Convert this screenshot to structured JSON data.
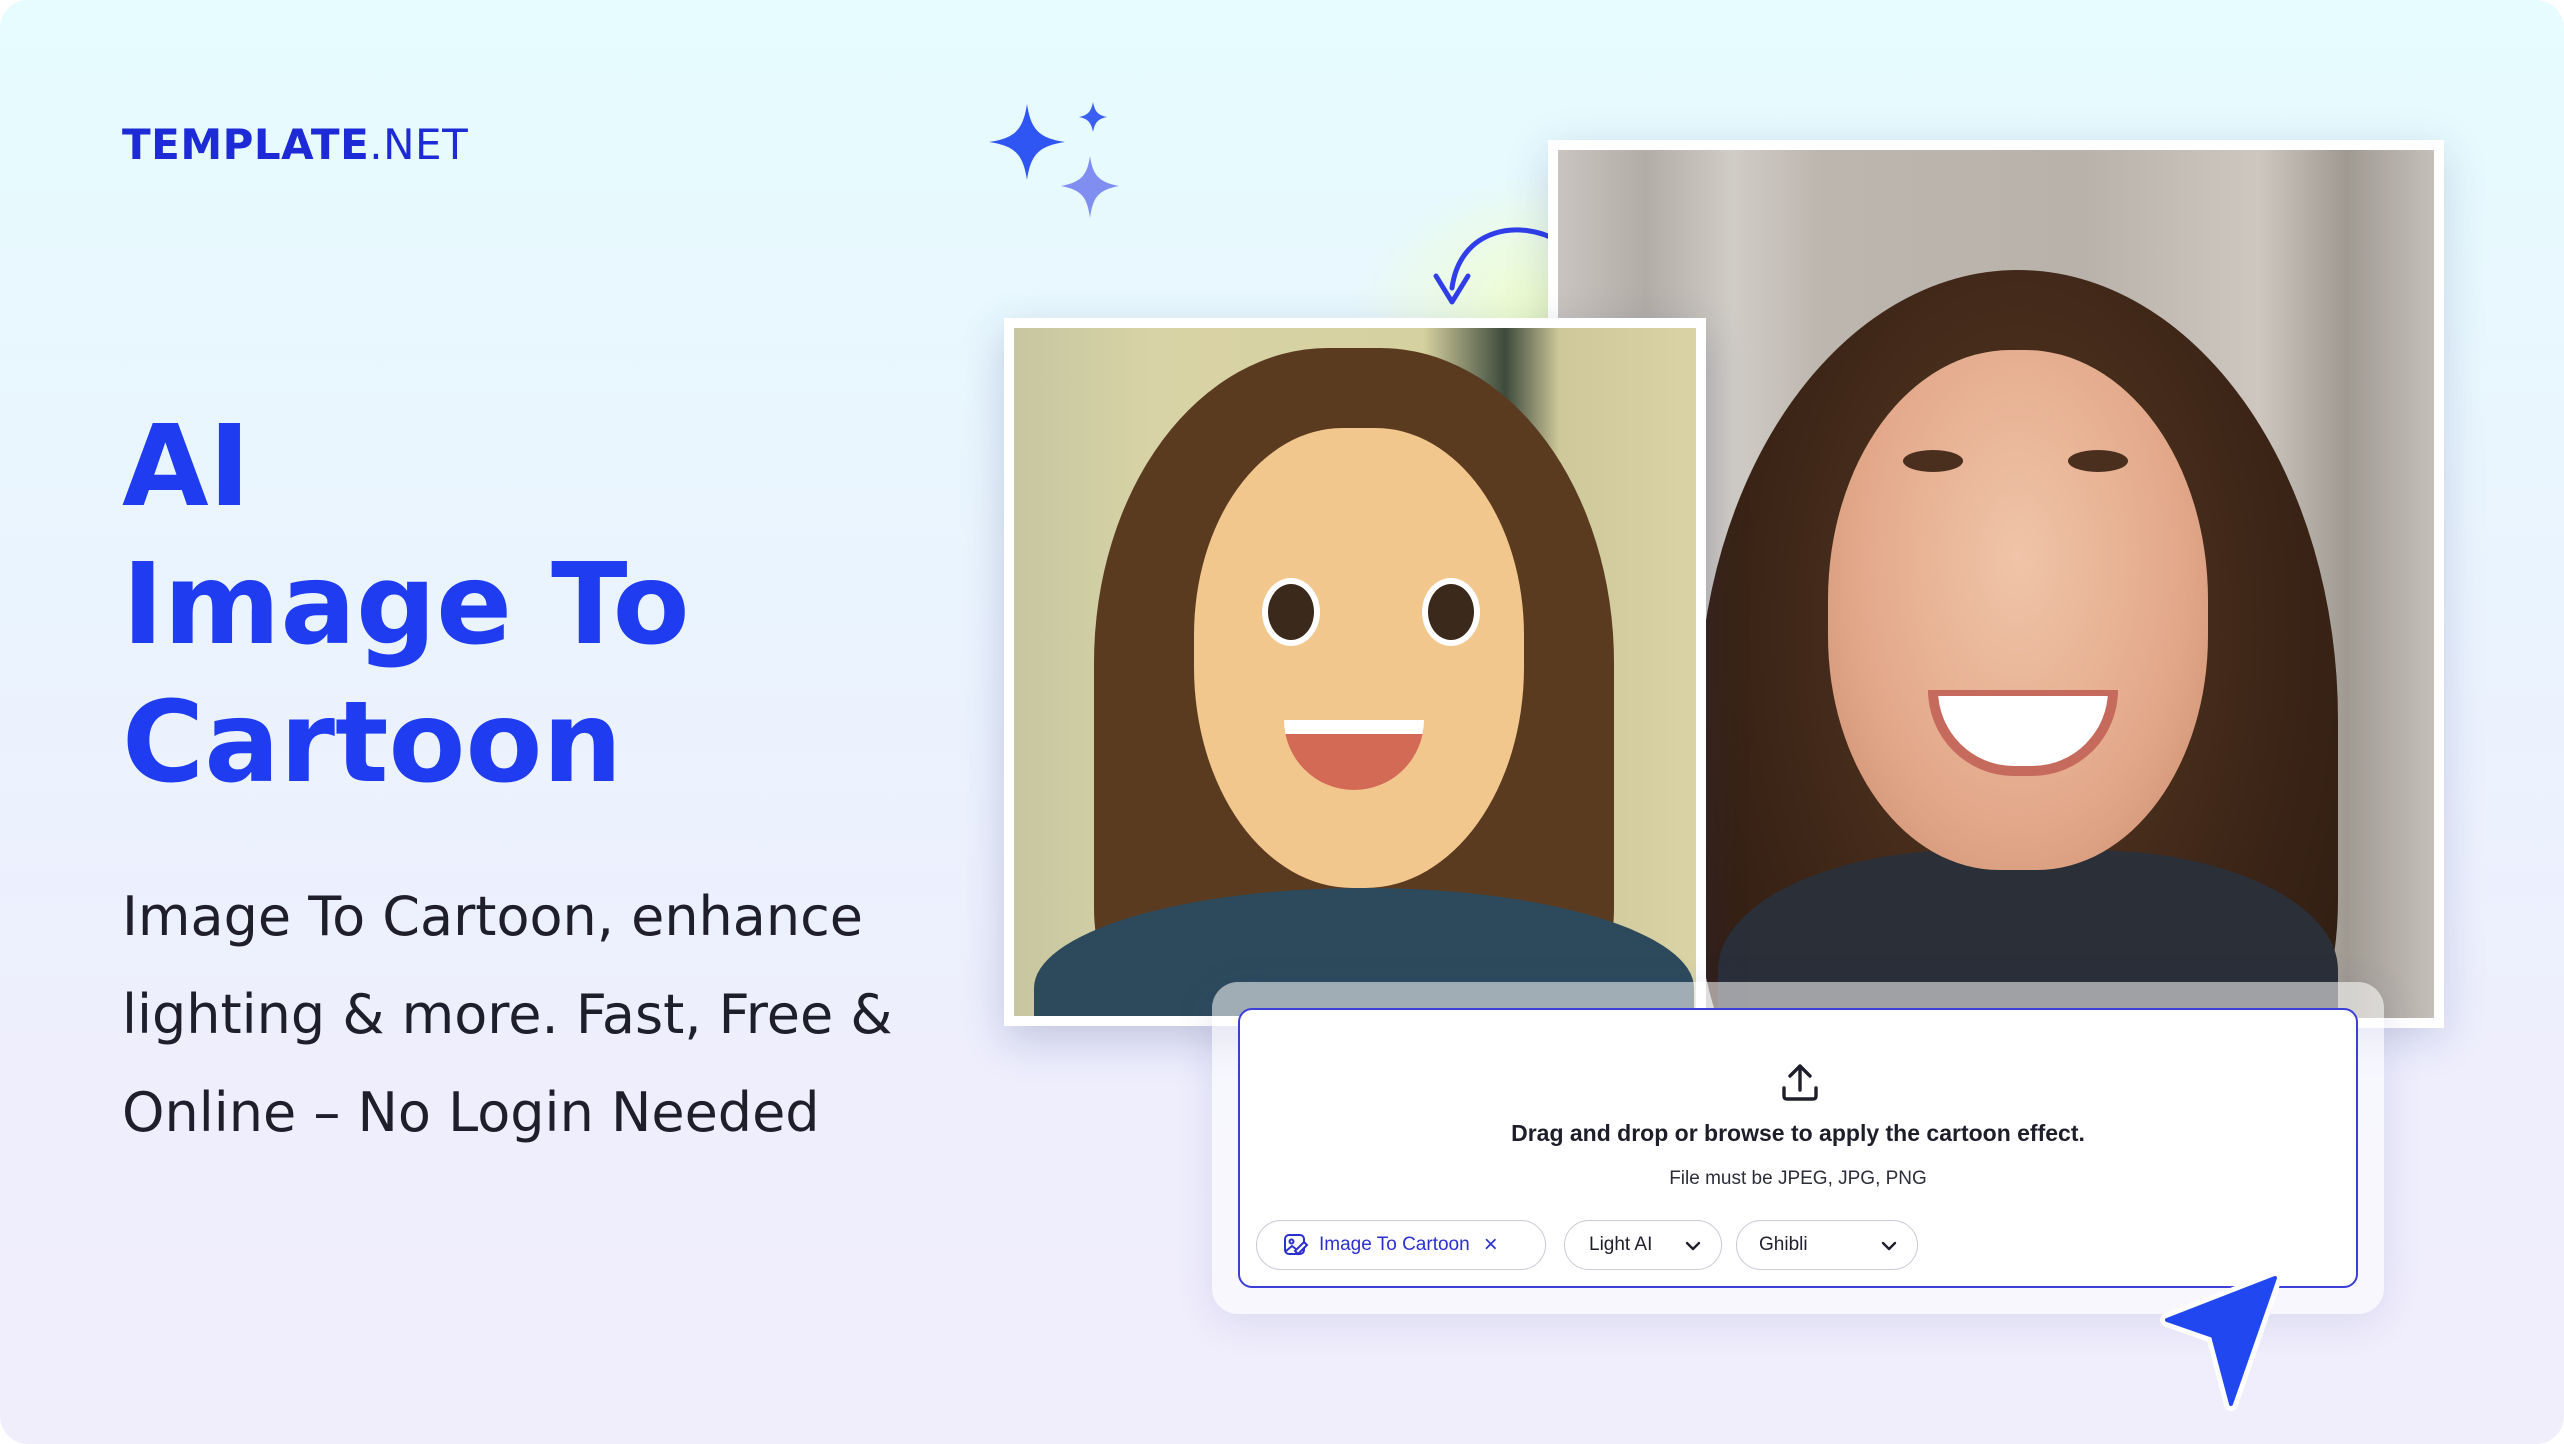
{
  "brand": {
    "logo_bold": "TEMPLATE",
    "logo_rest": ".NET"
  },
  "hero": {
    "title_lines": [
      "AI",
      "Image To",
      "Cartoon"
    ],
    "subtitle": "Image To Cartoon, enhance lighting & more. Fast, Free & Online – No Login Needed"
  },
  "upload": {
    "title": "Drag and drop or browse to apply the cartoon effect.",
    "hint": "File must be JPEG, JPG, PNG",
    "tool_chip": {
      "label": "Image To Cartoon",
      "remove_symbol": "×"
    },
    "model_select": {
      "value": "Light AI"
    },
    "style_select": {
      "value": "Ghibli"
    }
  },
  "colors": {
    "accent": "#1f3cf0",
    "panel_border": "#3b3fd8",
    "text_dark": "#1e1f2b"
  },
  "icons": [
    "sparkle-icon",
    "curved-arrow-icon",
    "upload-icon",
    "image-edit-icon",
    "close-icon",
    "chevron-down-icon",
    "cursor-pointer-icon"
  ]
}
